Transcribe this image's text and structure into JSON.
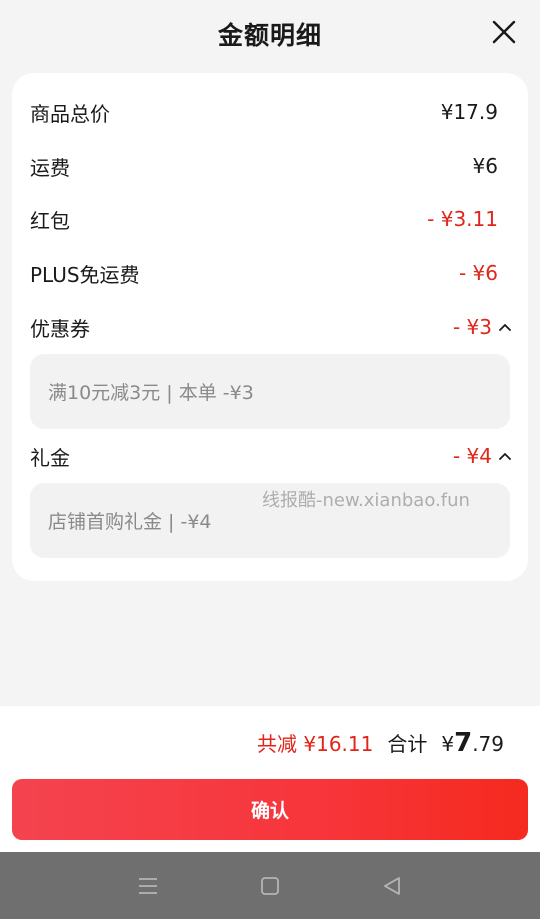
{
  "header": {
    "title": "金额明细"
  },
  "rows": [
    {
      "label": "商品总价",
      "amount": "¥17.9"
    },
    {
      "label": "运费",
      "amount": "¥6"
    },
    {
      "label": "红包",
      "amount": "- ¥3.11"
    },
    {
      "label": "PLUS免运费",
      "amount": "- ¥6"
    },
    {
      "label": "优惠券",
      "amount": "- ¥3",
      "detail": "满10元减3元 | 本单 -¥3"
    },
    {
      "label": "礼金",
      "amount": "- ¥4",
      "detail": "店铺首购礼金 | -¥4"
    }
  ],
  "watermark": "线报酷-new.xianbao.fun",
  "footer": {
    "saved": "共减 ¥16.11",
    "total_label": "合计",
    "total_currency": "¥",
    "total_int": "7",
    "total_dec": ".79",
    "confirm_label": "确认"
  },
  "colors": {
    "accent": "#e0251b",
    "button": "#f7353a"
  }
}
